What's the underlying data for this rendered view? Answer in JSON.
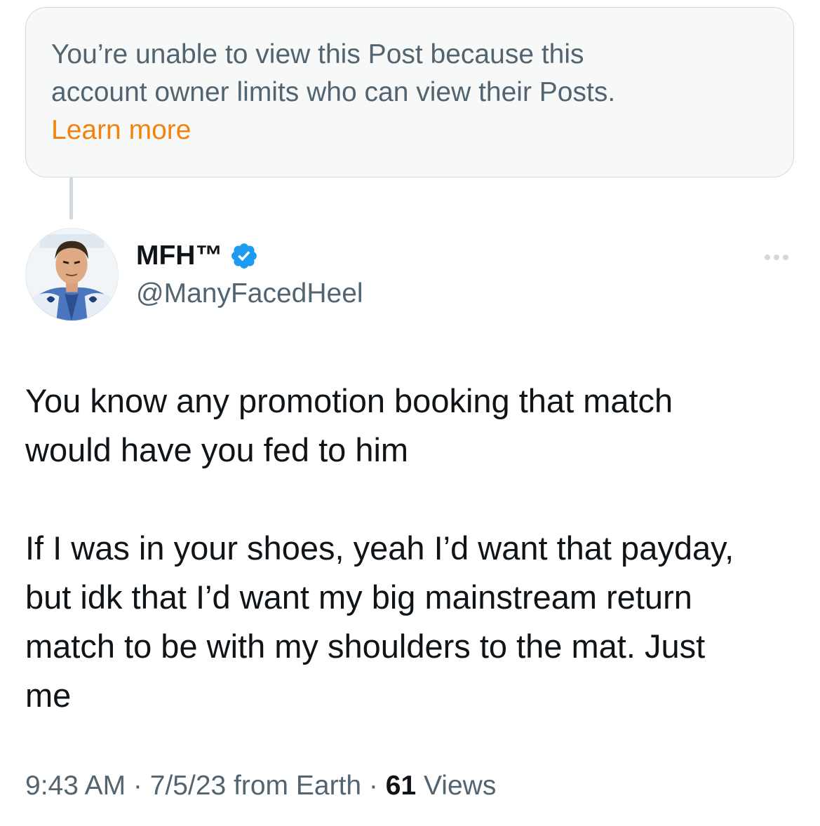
{
  "notice": {
    "line1": "You’re unable to view this Post because this",
    "line2": "account owner limits who can view their Posts.",
    "learn_more": "Learn more"
  },
  "author": {
    "display_name": "MFH™",
    "handle": "@ManyFacedHeel",
    "verified_icon": "verified-badge-icon",
    "more_icon": "more-options-icon"
  },
  "tweet": {
    "paragraph1": {
      "line1": "You know any promotion booking that match",
      "line2": "would have you fed to him"
    },
    "paragraph2": {
      "line1": "If I was in your shoes, yeah I’d want that payday,",
      "line2": "but idk that I’d want my big mainstream return",
      "line3": "match to be with my shoulders to the mat.  Just",
      "line4": "me"
    }
  },
  "meta": {
    "time": "9:43 AM",
    "separator": " · ",
    "date": "7/5/23",
    "source": " from Earth",
    "views_count": "61",
    "views_label": " Views"
  },
  "colors": {
    "accent_link": "#f4820f",
    "verified": "#1d9bf0",
    "secondary_text": "#536471"
  }
}
